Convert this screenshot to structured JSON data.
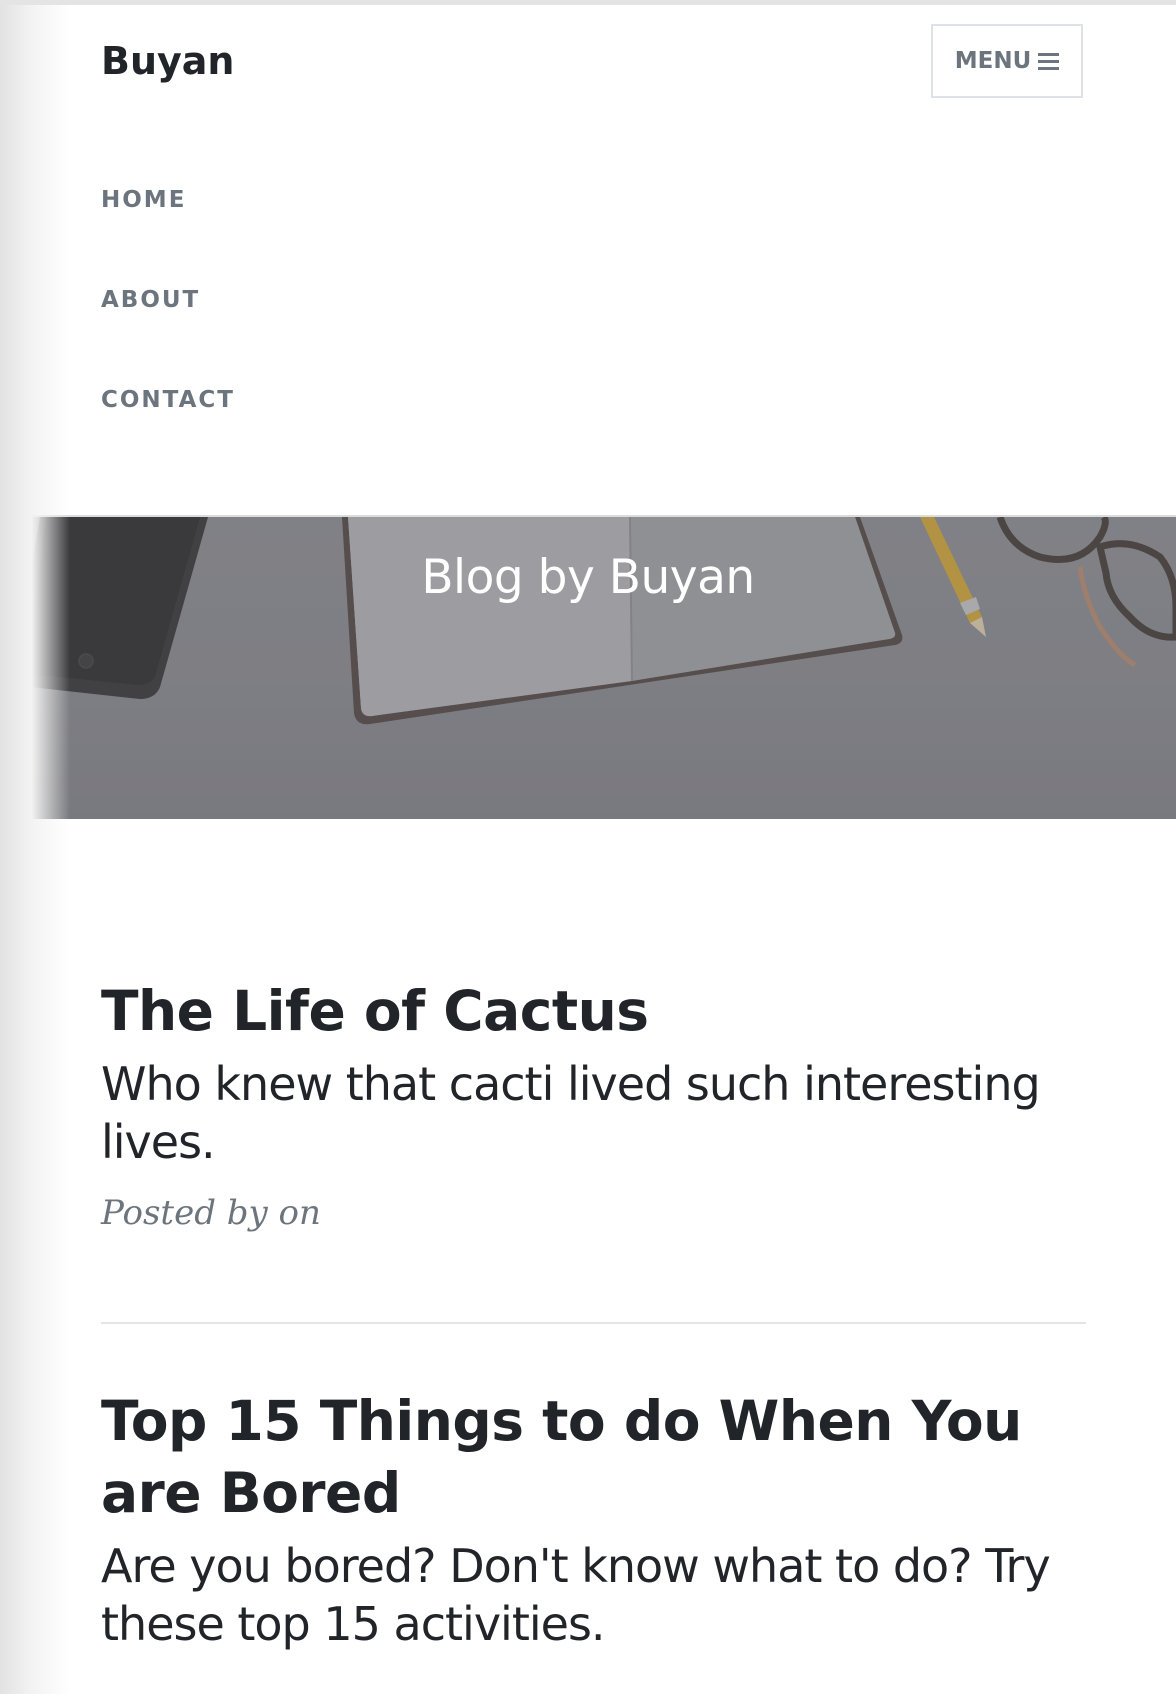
{
  "navbar": {
    "brand": "Buyan",
    "menu_label": "MENU",
    "items": [
      {
        "label": "HOME"
      },
      {
        "label": "ABOUT"
      },
      {
        "label": "CONTACT"
      }
    ]
  },
  "header": {
    "title": "Blog by Buyan"
  },
  "posts": [
    {
      "title": "The Life of Cactus",
      "subtitle": "Who knew that cacti lived such interesting lives.",
      "meta": "Posted by on"
    },
    {
      "title": "Top 15 Things to do When You are Bored",
      "subtitle": "Are you bored? Don't know what to do? Try these top 15 activities."
    }
  ],
  "icons": {
    "menu": "hamburger-icon"
  }
}
